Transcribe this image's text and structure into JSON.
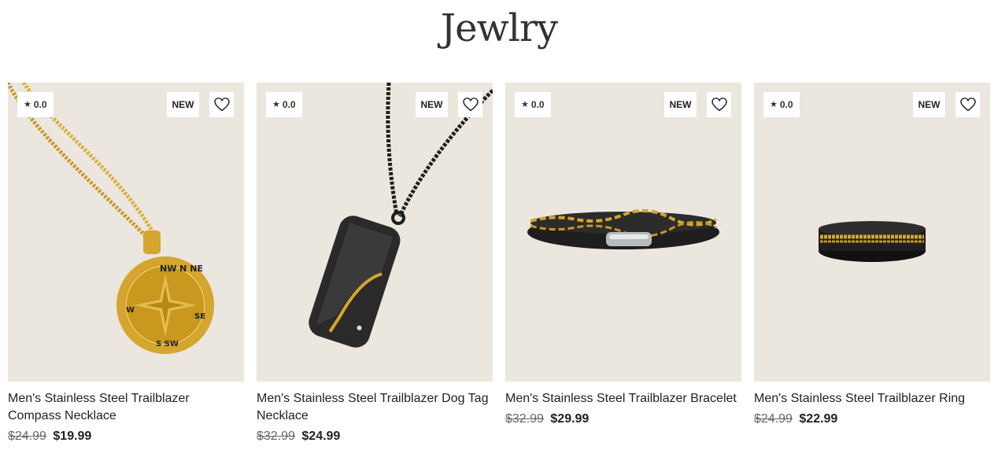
{
  "page": {
    "title": "Jewlry"
  },
  "products": [
    {
      "rating": "0.0",
      "badge": "NEW",
      "name": "Men's Stainless Steel Trailblazer Compass Necklace",
      "old_price": "$24.99",
      "price": "$19.99",
      "image_icon": "compass-necklace"
    },
    {
      "rating": "0.0",
      "badge": "NEW",
      "name": "Men's Stainless Steel Trailblazer Dog Tag Necklace",
      "old_price": "$32.99",
      "price": "$24.99",
      "image_icon": "dog-tag-necklace"
    },
    {
      "rating": "0.0",
      "badge": "NEW",
      "name": "Men's Stainless Steel Trailblazer Bracelet",
      "old_price": "$32.99",
      "price": "$29.99",
      "image_icon": "bracelet"
    },
    {
      "rating": "0.0",
      "badge": "NEW",
      "name": "Men's Stainless Steel Trailblazer Ring",
      "old_price": "$24.99",
      "price": "$22.99",
      "image_icon": "ring"
    }
  ],
  "colors": {
    "photo_bg": "#ebe6de",
    "gold": "#d4a62e",
    "black": "#1e1e1e"
  }
}
